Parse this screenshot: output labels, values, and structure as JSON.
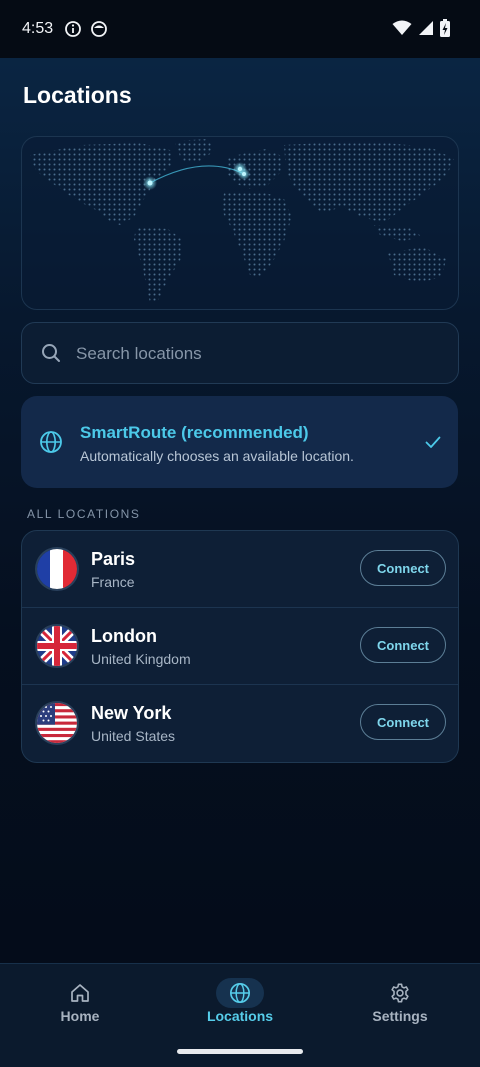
{
  "status_bar": {
    "time": "4:53"
  },
  "page": {
    "title": "Locations"
  },
  "search": {
    "placeholder": "Search locations",
    "value": ""
  },
  "smart_route": {
    "title": "SmartRoute (recommended)",
    "subtitle": "Automatically chooses an available location.",
    "selected": true
  },
  "section": {
    "label": "ALL LOCATIONS"
  },
  "locations": [
    {
      "city": "Paris",
      "country": "France",
      "flag": "france-flag",
      "button": "Connect"
    },
    {
      "city": "London",
      "country": "United Kingdom",
      "flag": "uk-flag",
      "button": "Connect"
    },
    {
      "city": "New York",
      "country": "United States",
      "flag": "us-flag",
      "button": "Connect"
    }
  ],
  "nav": {
    "items": [
      {
        "label": "Home",
        "icon": "home-icon",
        "active": false
      },
      {
        "label": "Locations",
        "icon": "globe-icon",
        "active": true
      },
      {
        "label": "Settings",
        "icon": "gear-icon",
        "active": false
      }
    ]
  },
  "colors": {
    "accent": "#4cc9e9",
    "background": "#050f1f",
    "card": "#13294a"
  }
}
